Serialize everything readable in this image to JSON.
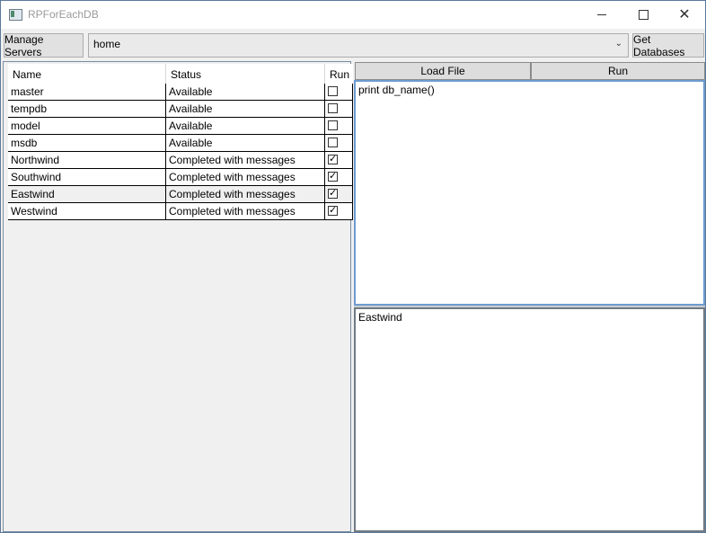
{
  "window": {
    "title": "RPForEachDB"
  },
  "toolbar": {
    "manage_label": "Manage Servers",
    "server_value": "home",
    "get_databases_label": "Get Databases"
  },
  "grid": {
    "headers": {
      "name": "Name",
      "status": "Status",
      "run": "Run"
    },
    "rows": [
      {
        "name": "master",
        "status": "Available",
        "run": false
      },
      {
        "name": "tempdb",
        "status": "Available",
        "run": false
      },
      {
        "name": "model",
        "status": "Available",
        "run": false
      },
      {
        "name": "msdb",
        "status": "Available",
        "run": false
      },
      {
        "name": "Northwind",
        "status": "Completed with messages",
        "run": true
      },
      {
        "name": "Southwind",
        "status": "Completed with messages",
        "run": true
      },
      {
        "name": "Eastwind",
        "status": "Completed with messages",
        "run": true
      },
      {
        "name": "Westwind",
        "status": "Completed with messages",
        "run": true
      }
    ]
  },
  "script": {
    "load_label": "Load File",
    "run_label": "Run",
    "query_text": "print db_name()",
    "output_text": "Eastwind"
  }
}
